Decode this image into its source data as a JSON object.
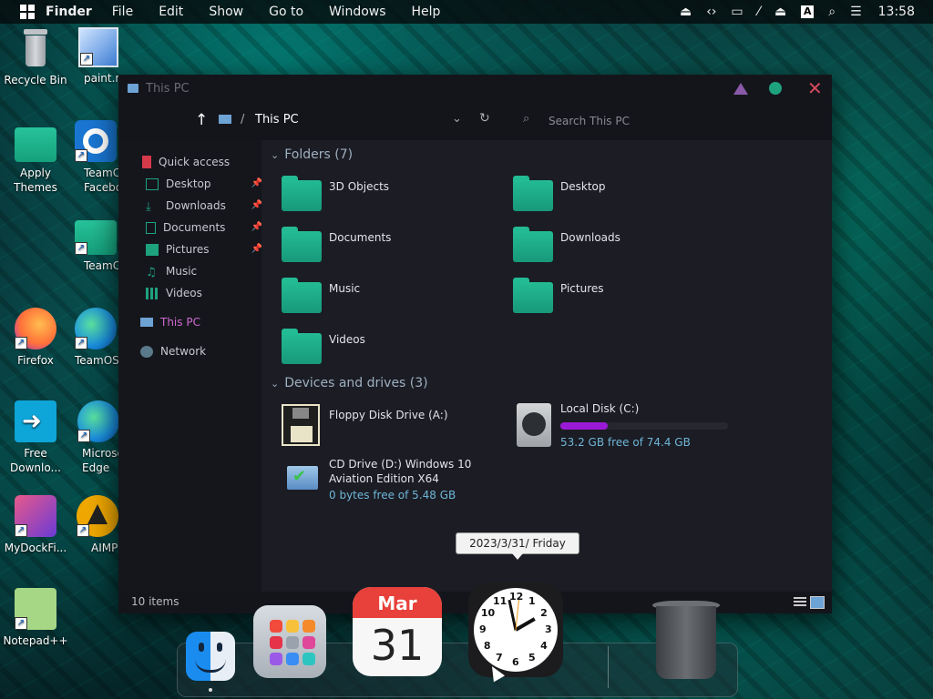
{
  "menubar": {
    "app_name": "Finder",
    "items": [
      "File",
      "Edit",
      "Show",
      "Go to",
      "Windows",
      "Help"
    ],
    "keyboard_indicator": "A",
    "clock": "13:58"
  },
  "desktop_icons": [
    {
      "label": "Recycle Bin",
      "icon": "recycle-bin-icon"
    },
    {
      "label": "paint.n",
      "icon": "paint-icon"
    },
    {
      "label": "Apply Themes",
      "icon": "folder-icon"
    },
    {
      "label": "TeamC Facebo",
      "icon": "settings-gear-icon"
    },
    {
      "label": "TeamC",
      "icon": "folder-icon"
    },
    {
      "label": "Firefox",
      "icon": "firefox-icon"
    },
    {
      "label": "TeamOS",
      "icon": "edge-icon"
    },
    {
      "label": "Free Downlo...",
      "icon": "download-arrow-icon"
    },
    {
      "label": "Microso Edge",
      "icon": "edge-icon"
    },
    {
      "label": "MyDockFi...",
      "icon": "dock-icon"
    },
    {
      "label": "AIMP",
      "icon": "aimp-icon"
    },
    {
      "label": "Notepad++",
      "icon": "notepad-icon"
    }
  ],
  "explorer": {
    "window_title": "This PC",
    "breadcrumb": "This PC",
    "search_placeholder": "Search This PC",
    "sidebar": [
      {
        "label": "Quick access",
        "icon": "star-bookmark-icon"
      },
      {
        "label": "Desktop",
        "icon": "desktop-icon",
        "pinned": true
      },
      {
        "label": "Downloads",
        "icon": "download-icon",
        "pinned": true
      },
      {
        "label": "Documents",
        "icon": "document-icon",
        "pinned": true
      },
      {
        "label": "Pictures",
        "icon": "picture-icon",
        "pinned": true
      },
      {
        "label": "Music",
        "icon": "music-icon"
      },
      {
        "label": "Videos",
        "icon": "video-icon"
      },
      {
        "label": "This PC",
        "icon": "computer-icon",
        "selected": true
      },
      {
        "label": "Network",
        "icon": "network-icon"
      }
    ],
    "folders_header": "Folders (7)",
    "folders": [
      "3D Objects",
      "Desktop",
      "Documents",
      "Downloads",
      "Music",
      "Pictures",
      "Videos"
    ],
    "drives_header": "Devices and drives (3)",
    "drives": [
      {
        "name": "Floppy Disk Drive (A:)",
        "free": ""
      },
      {
        "name": "Local Disk (C:)",
        "free": "53.2 GB free of 74.4 GB",
        "used_fraction": 0.285
      },
      {
        "name_line1": "CD Drive (D:) Windows 10",
        "name_line2": "Aviation Edition X64",
        "free": "0 bytes free of 5.48 GB"
      }
    ],
    "status": "10 items"
  },
  "tooltip": "2023/3/31/ Friday",
  "dock": {
    "calendar_month": "Mar",
    "calendar_day": "31",
    "clock_numbers": [
      "12",
      "1",
      "2",
      "3",
      "4",
      "5",
      "6",
      "7",
      "8",
      "9",
      "10",
      "11"
    ]
  },
  "colors": {
    "accent_teal": "#1ea27e",
    "selected_purple": "#d06ad0",
    "drive_bar": "#9a1ad6",
    "free_text": "#6fb6d6"
  }
}
